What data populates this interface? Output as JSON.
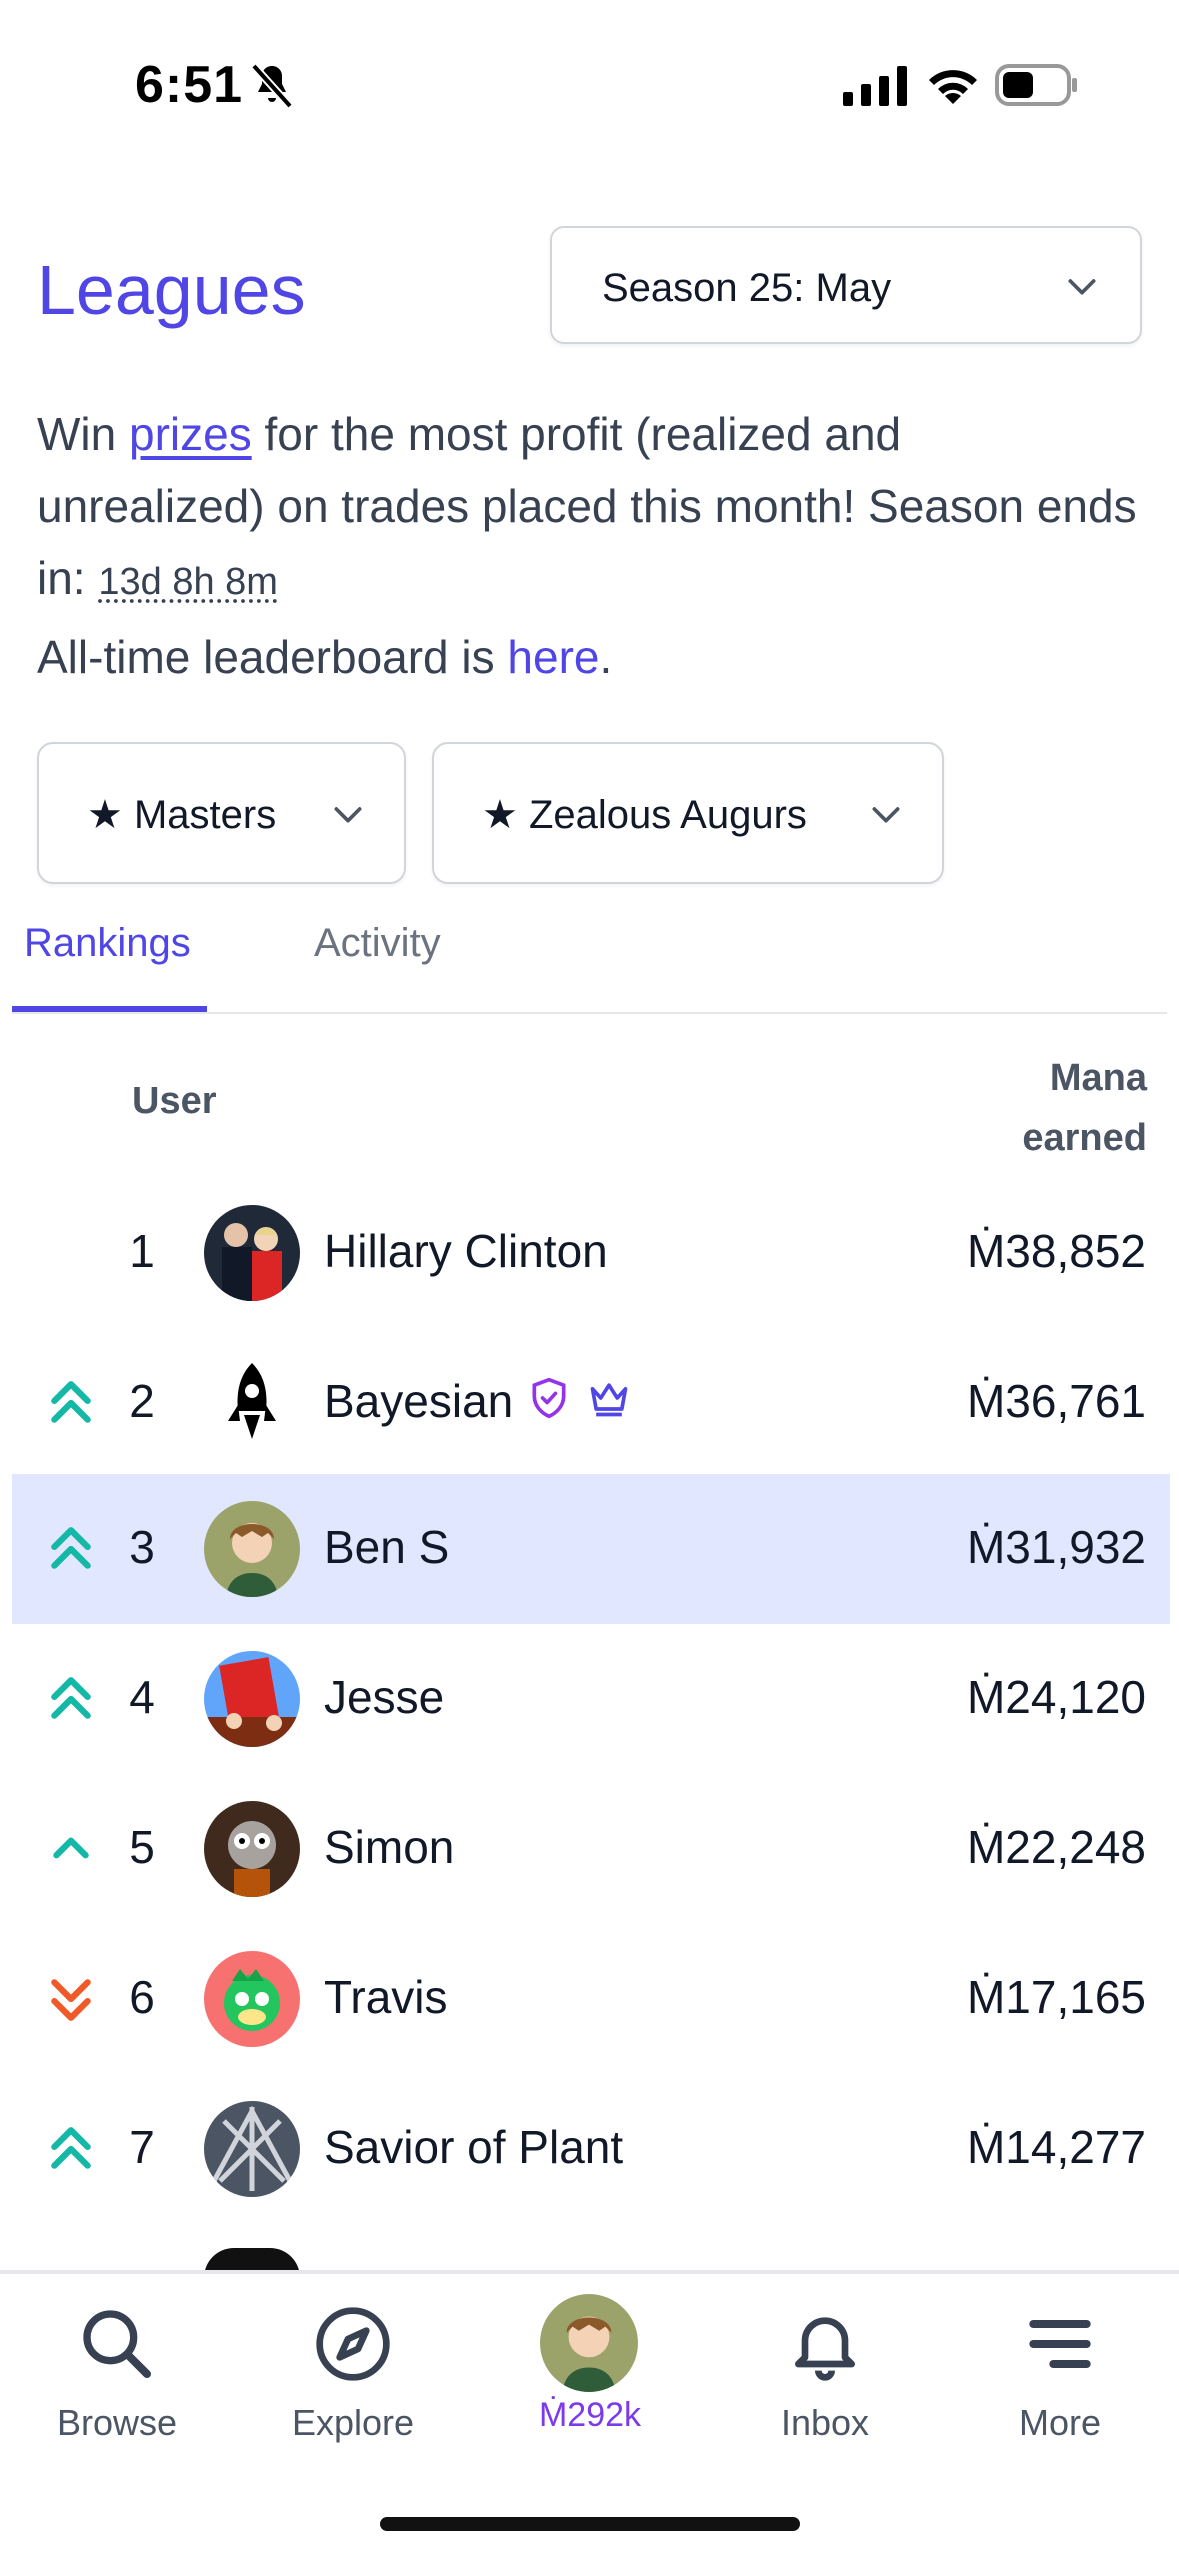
{
  "status_bar": {
    "time": "6:51"
  },
  "header": {
    "title": "Leagues",
    "season_select": "Season 25: May"
  },
  "description": {
    "part1": "Win ",
    "prizes_link": "prizes",
    "part2": " for the most profit (realized and unrealized) on trades placed this month! Season ends in: ",
    "timer": "13d 8h 8m",
    "alltime_prefix": "All-time leaderboard is ",
    "here_link": "here",
    "alltime_suffix": "."
  },
  "filters": {
    "division": "★ Masters",
    "cohort": "★ Zealous Augurs"
  },
  "tabs": [
    {
      "label": "Rankings",
      "active": true
    },
    {
      "label": "Activity",
      "active": false
    }
  ],
  "table": {
    "col_user": "User",
    "col_mana_line1": "Mana",
    "col_mana_line2": "earned",
    "rows": [
      {
        "rank": "1",
        "name": "Hillary Clinton",
        "amount": "Ṁ38,852",
        "trend": "none"
      },
      {
        "rank": "2",
        "name": "Bayesian",
        "amount": "Ṁ36,761",
        "trend": "up-double"
      },
      {
        "rank": "3",
        "name": "Ben S",
        "amount": "Ṁ31,932",
        "trend": "up-double",
        "highlight": true
      },
      {
        "rank": "4",
        "name": "Jesse",
        "amount": "Ṁ24,120",
        "trend": "up-double"
      },
      {
        "rank": "5",
        "name": "Simon",
        "amount": "Ṁ22,248",
        "trend": "up-single"
      },
      {
        "rank": "6",
        "name": "Travis",
        "amount": "Ṁ17,165",
        "trend": "down-double"
      },
      {
        "rank": "7",
        "name": "Savior of Plant",
        "amount": "Ṁ14,277",
        "trend": "up-double"
      }
    ]
  },
  "bottom_nav": {
    "browse": "Browse",
    "explore": "Explore",
    "balance": "Ṁ292k",
    "inbox": "Inbox",
    "more": "More"
  },
  "colors": {
    "accent": "#4f46e5",
    "trend_up": "#14b8a6",
    "trend_down": "#f05a28",
    "highlight_row": "#e0e7ff"
  }
}
